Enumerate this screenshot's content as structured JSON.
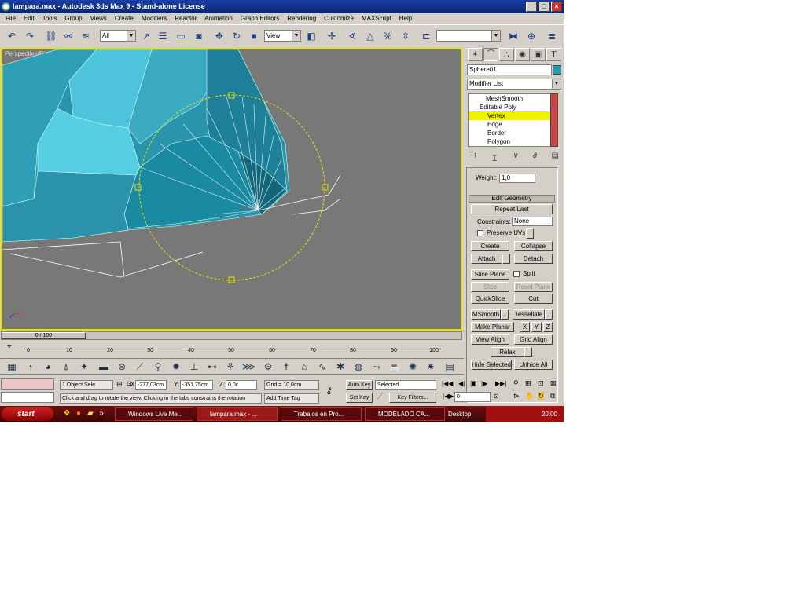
{
  "window": {
    "title": "lampara.max - Autodesk 3ds Max 9 - Stand-alone License",
    "min": "_",
    "max": "□",
    "close": "×"
  },
  "menu": [
    "File",
    "Edit",
    "Tools",
    "Group",
    "Views",
    "Create",
    "Modifiers",
    "Reactor",
    "Animation",
    "Graph Editors",
    "Rendering",
    "Customize",
    "MAXScript",
    "Help"
  ],
  "toolbar": {
    "selection_filter": "All",
    "ref_coord": "View",
    "named_sel": ""
  },
  "viewport": {
    "label": "Perspective/Disabled"
  },
  "panel": {
    "object_name": "Sphere01",
    "object_color": "#1fa0b0",
    "modifier_list": "Modifier List",
    "stack": [
      "MeshSmooth",
      "Editable Poly",
      "Vertex",
      "Edge",
      "Border",
      "Polygon"
    ],
    "weight_label": "Weight:",
    "weight_value": "1,0",
    "rollout_title": "Edit Geometry",
    "repeat_last": "Repeat Last",
    "constraints_label": "Constraints:",
    "constraints_value": "None",
    "preserve_uvs": "Preserve UVs",
    "create": "Create",
    "collapse": "Collapse",
    "attach": "Attach",
    "detach": "Detach",
    "slice_plane": "Slice Plane",
    "split": "Split",
    "slice": "Slice",
    "reset_plane": "Reset Plane",
    "quickslice": "QuickSlice",
    "cut": "Cut",
    "msmooth": "MSmooth",
    "tessellate": "Tessellate",
    "make_planar": "Make Planar",
    "x": "X",
    "y": "Y",
    "z": "Z",
    "view_align": "View Align",
    "grid_align": "Grid Align",
    "relax": "Relax",
    "hide_selected": "Hide Selected",
    "unhide_all": "Unhide All"
  },
  "timeline": {
    "slider": "0 / 100",
    "ticks": [
      "0",
      "10",
      "20",
      "30",
      "40",
      "50",
      "60",
      "70",
      "80",
      "90",
      "100"
    ]
  },
  "status": {
    "selected": "1 Object Sele",
    "x_label": "X:",
    "x": "-277,03cm",
    "y_label": "Y:",
    "y": "-351,75cm",
    "z_label": "Z:",
    "z": "0,0c",
    "grid": "Grid = 10,0cm",
    "prompt": "Click and drag to rotate the view.  Clicking in the tabs constrains the rotation",
    "add_time_tag": "Add Time Tag",
    "auto_key": "Auto Key",
    "auto_key_value": "Selected",
    "set_key": "Set Key",
    "key_filters": "Key Filters...",
    "frame": "0"
  },
  "taskbar": {
    "start": "start",
    "tasks": [
      "Windows Live Me...",
      "lampara.max - ...",
      "Trabajos en Pro...",
      "MODELADO CA..."
    ],
    "desktop": "Desktop",
    "clock": "20:00"
  }
}
